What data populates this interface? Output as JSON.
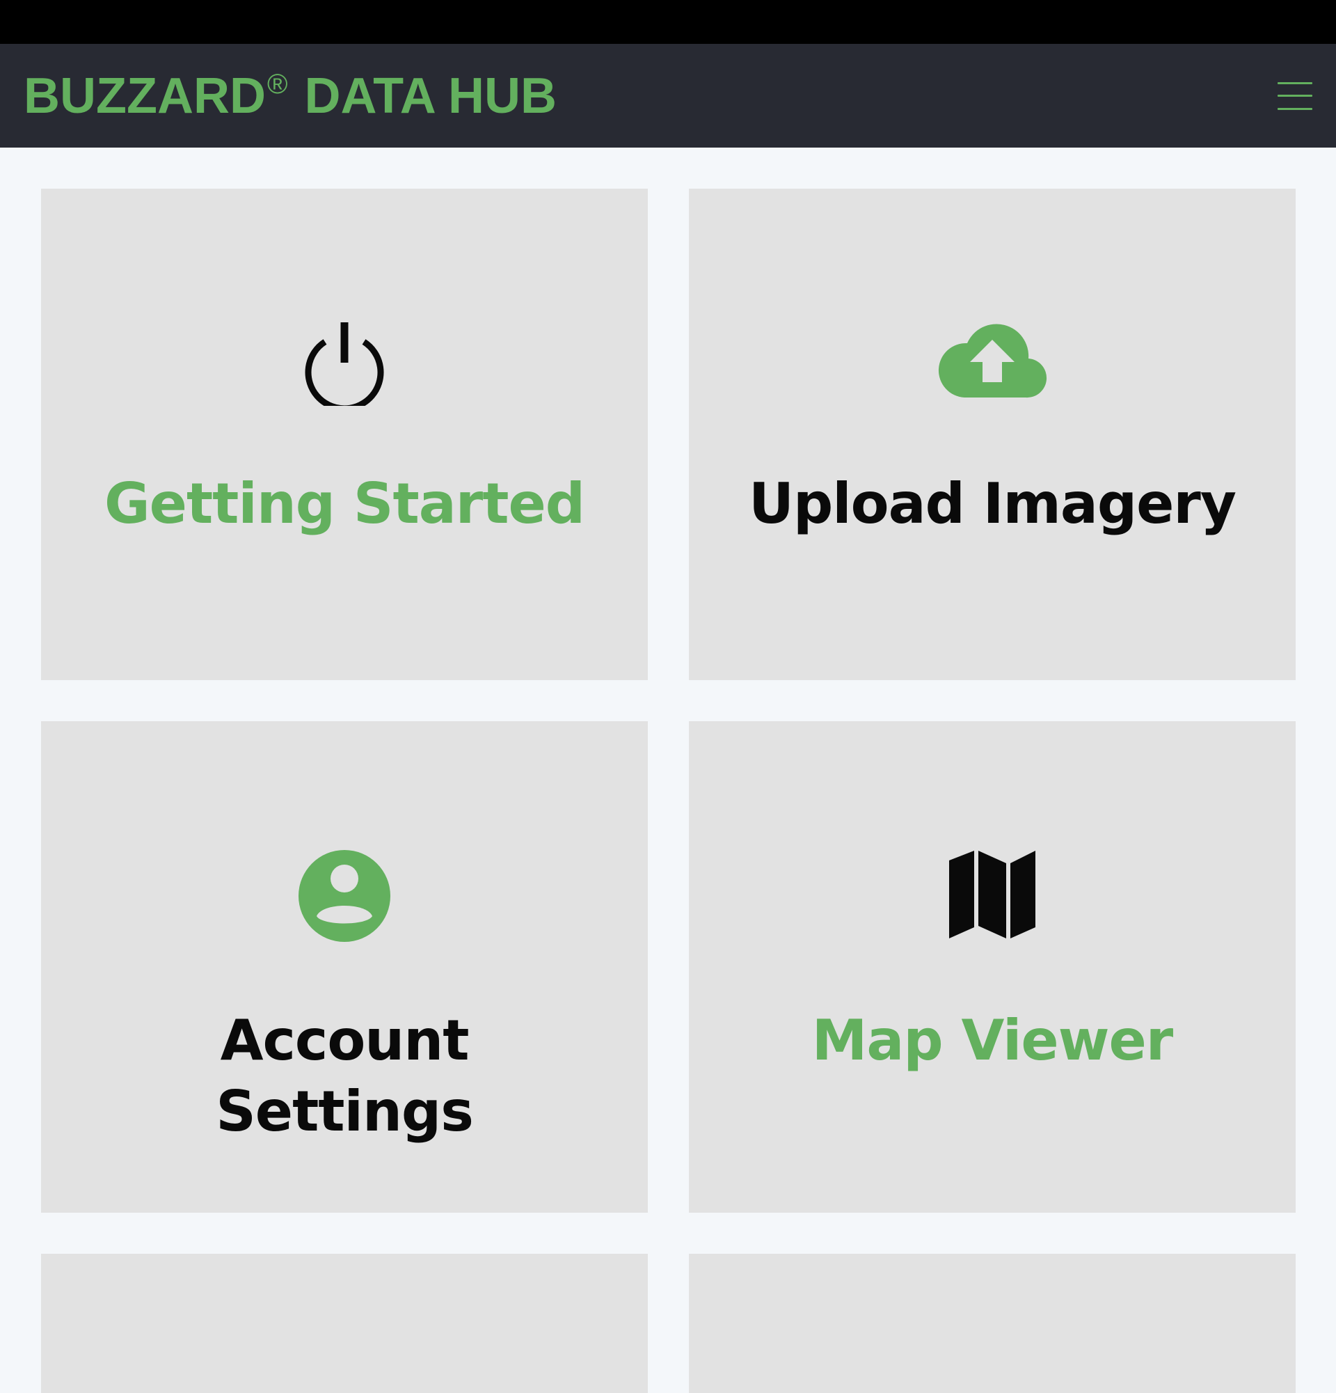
{
  "header": {
    "brand_main": "BUZZARD",
    "brand_mark": "®",
    "brand_rest": " DATA HUB",
    "menu_icon": "hamburger-menu-icon"
  },
  "colors": {
    "accent": "#63b05e",
    "header_bg": "#282a33",
    "tile_bg": "#e2e2e2",
    "page_bg": "#f4f7fa"
  },
  "tiles": [
    {
      "label": "Getting Started",
      "icon": "power-icon",
      "label_color": "#63b05e",
      "icon_color": "#0a0a0a"
    },
    {
      "label": "Upload Imagery",
      "icon": "cloud-upload-icon",
      "label_color": "#0a0a0a",
      "icon_color": "#63b05e"
    },
    {
      "label": "Account Settings",
      "icon": "account-circle-icon",
      "label_color": "#0a0a0a",
      "icon_color": "#63b05e"
    },
    {
      "label": "Map Viewer",
      "icon": "map-icon",
      "label_color": "#63b05e",
      "icon_color": "#0a0a0a"
    }
  ]
}
